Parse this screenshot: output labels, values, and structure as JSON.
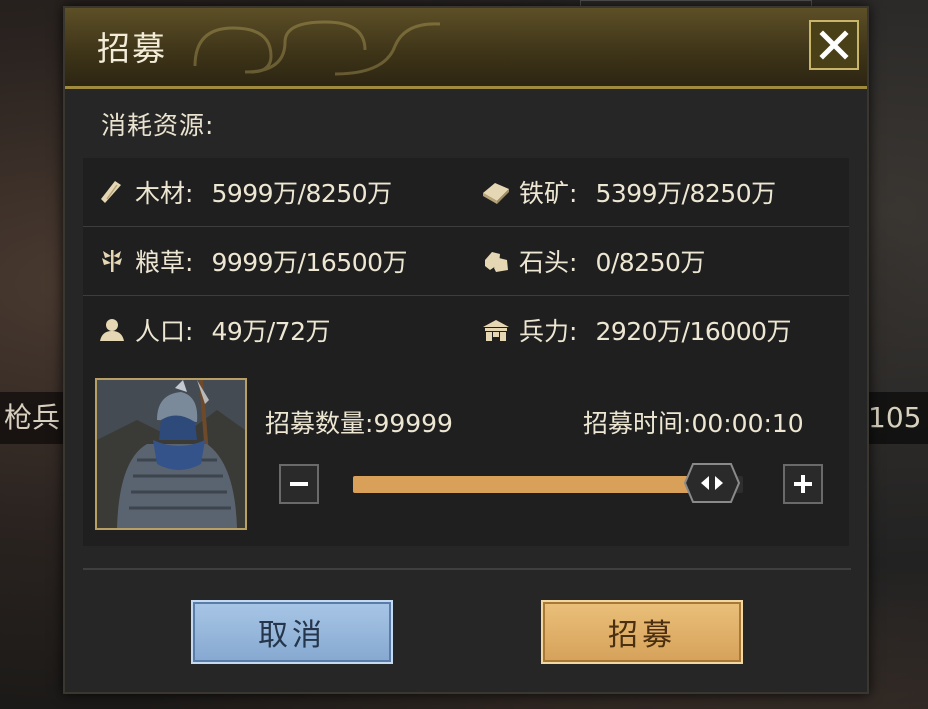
{
  "background": {
    "left_label": "枪兵",
    "right_label": "105"
  },
  "dialog": {
    "title": "招募",
    "close_icon": "close-icon",
    "section_label": "消耗资源:",
    "resources": [
      [
        {
          "icon": "wood-icon",
          "label": "木材:",
          "value": "5999万/8250万"
        },
        {
          "icon": "iron-icon",
          "label": "铁矿:",
          "value": "5399万/8250万"
        }
      ],
      [
        {
          "icon": "grain-icon",
          "label": "粮草:",
          "value": "9999万/16500万"
        },
        {
          "icon": "stone-icon",
          "label": "石头:",
          "value": "0/8250万"
        }
      ],
      [
        {
          "icon": "population-icon",
          "label": "人口:",
          "value": "49万/72万"
        },
        {
          "icon": "troops-icon",
          "label": "兵力:",
          "value": "2920万/16000万"
        }
      ]
    ],
    "recruit": {
      "count_label": "招募数量:",
      "count_value": "99999",
      "time_label": "招募时间:",
      "time_value": "00:00:10",
      "slider_fraction": 0.92
    },
    "buttons": {
      "cancel": "取消",
      "recruit": "招募"
    },
    "colors": {
      "accent_gold": "#d9a05a",
      "cancel_blue": "#96b6dc",
      "title_bar": "#4a3f1e"
    }
  }
}
